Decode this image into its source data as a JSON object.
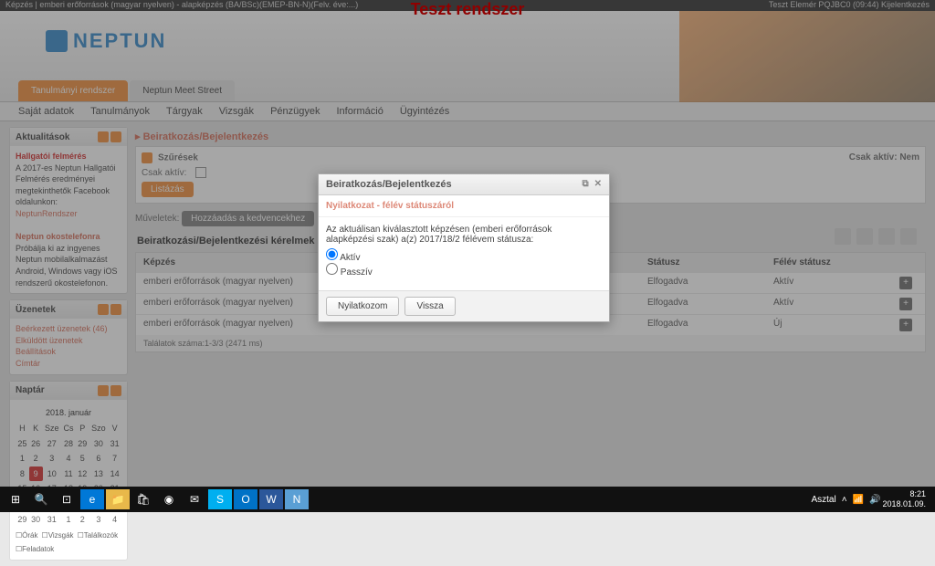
{
  "topbar": {
    "left": "Képzés | emberi erőforrások (magyar nyelven) - alapképzés (BA/BSc)(EMEP-BN-N)(Felv. éve:...)",
    "right": "Teszt Elemér  PQJBC0  (09:44)  Kijelentkezés"
  },
  "banner": "Teszt rendszer",
  "logo": "NEPTUN",
  "header_tabs": {
    "main": "Tanulmányi rendszer",
    "sec": "Neptun Meet Street"
  },
  "menu": [
    "Saját adatok",
    "Tanulmányok",
    "Tárgyak",
    "Vizsgák",
    "Pénzügyek",
    "Információ",
    "Ügyintézés"
  ],
  "sidebar": {
    "news_title": "Aktualitások",
    "news_sub": "Hallgatói felmérés",
    "news_body": "A 2017-es Neptun Hallgatói Felmérés eredményei megtekinthetők Facebook oldalunkon:",
    "news_link": "NeptunRendszer",
    "phone_title": "Neptun okostelefonra",
    "phone_body": "Próbálja ki az ingyenes Neptun mobilalkalmazást Android, Windows vagy iOS rendszerű okostelefonon.",
    "msg_title": "Üzenetek",
    "msg_items": [
      "Beérkezett üzenetek (46)",
      "Elküldött üzenetek",
      "Beállítások",
      "Címtár"
    ],
    "cal_title": "Naptár",
    "cal_month": "2018. január",
    "cal_days": [
      "H",
      "K",
      "Sze",
      "Cs",
      "P",
      "Szo",
      "V"
    ],
    "cal_today": "9",
    "cal_legend": [
      "Órák",
      "Vizsgák",
      "Találkozók",
      "Feladatok"
    ]
  },
  "main": {
    "crumb": "Beiratkozás/Bejelentkezés",
    "filter_label": "Szűrések",
    "filter_active": "Csak aktív: Nem",
    "row_label": "Csak aktív:",
    "btn_list": "Listázás",
    "actions": "Műveletek:",
    "action_btn": "Hozzáadás a kedvencekhez",
    "section": "Beiratkozási/Bejelentkezési kérelmek",
    "cols": {
      "c1": "Képzés",
      "c2": "Státusz",
      "c3": "Félév státusz"
    },
    "rows": [
      {
        "c1": "emberi erőforrások (magyar nyelven)",
        "c2": "Elfogadva",
        "c3": "Aktív"
      },
      {
        "c1": "emberi erőforrások (magyar nyelven)",
        "c2": "Elfogadva",
        "c3": "Aktív"
      },
      {
        "c1": "emberi erőforrások (magyar nyelven)",
        "c2": "Elfogadva",
        "c3": "Új"
      }
    ],
    "footer": "Találatok száma:1-3/3 (2471 ms)"
  },
  "modal": {
    "title": "Beiratkozás/Bejelentkezés",
    "subtitle": "Nyilatkozat - félév státuszáról",
    "body": "Az aktuálisan kiválasztott képzésen (emberi erőforrások alapképzési szak) a(z) 2017/18/2 félévem státusza:",
    "opt1": "Aktív",
    "opt2": "Passzív",
    "btn_ok": "Nyilatkozom",
    "btn_back": "Vissza"
  },
  "taskbar": {
    "time": "8:21",
    "date": "2018.01.09.",
    "lang": "Asztal"
  }
}
